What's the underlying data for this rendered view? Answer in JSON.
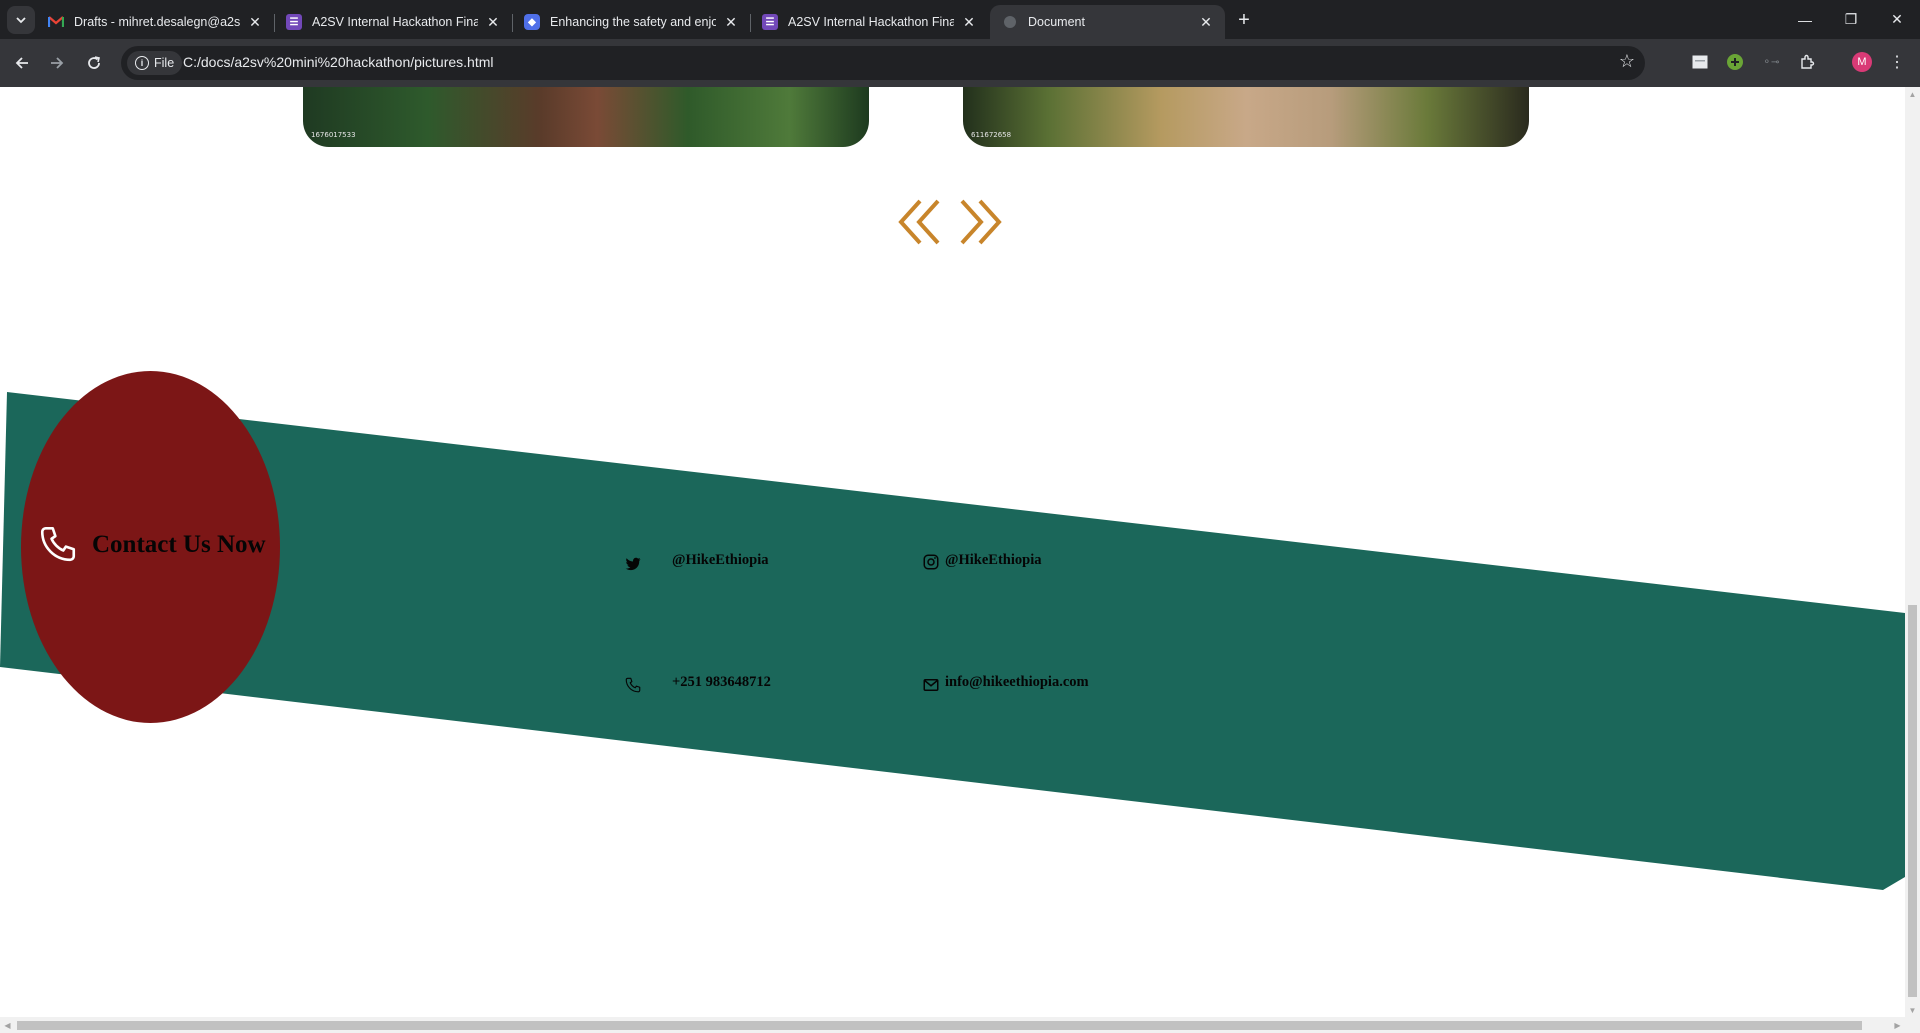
{
  "browser": {
    "tabs": [
      {
        "title": "Drafts - mihret.desalegn@a2sv",
        "icon": "gmail-icon",
        "active": false
      },
      {
        "title": "A2SV Internal Hackathon Final",
        "icon": "forms-icon",
        "active": false
      },
      {
        "title": "Enhancing the safety and enjoy",
        "icon": "shield-icon",
        "active": false
      },
      {
        "title": "A2SV Internal Hackathon Final",
        "icon": "forms-icon",
        "active": false
      },
      {
        "title": "Document",
        "icon": "globe-icon",
        "active": true
      }
    ],
    "address_chip": "File",
    "url": "C:/docs/a2sv%20mini%20hackathon/pictures.html",
    "profile_initial": "M"
  },
  "gallery": {
    "left_credit": "1676017533",
    "right_credit": "611672658"
  },
  "contact": {
    "title": "Contact Us Now",
    "twitter": "@HikeEthiopia",
    "instagram": "@HikeEthiopia",
    "phone": "+251 983648712",
    "email": "info@hikeethiopia.com"
  },
  "colors": {
    "band": "#1b675a",
    "oval": "#7c1616",
    "arrows": "#c8852b",
    "text": "#050505"
  }
}
